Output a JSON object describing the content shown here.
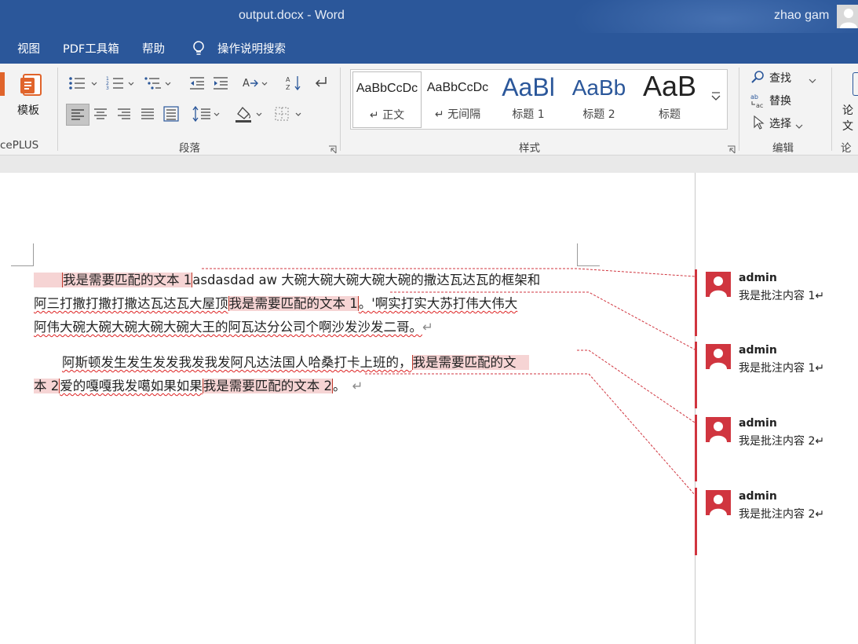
{
  "window": {
    "title": "output.docx  -  Word",
    "user": "zhao gam"
  },
  "menu": [
    "视图",
    "PDF工具箱",
    "帮助",
    "操作说明搜索"
  ],
  "ribbon": {
    "left_button": "模板",
    "left_group_label": "cePLUS",
    "paragraph_label": "段落",
    "styles_label": "样式",
    "editing_label": "编辑",
    "paper_label": "论文",
    "paper_group_label": "论文",
    "styles": [
      {
        "preview": "AaBbCcDc",
        "name": "↵ 正文"
      },
      {
        "preview": "AaBbCcDc",
        "name": "↵ 无间隔"
      },
      {
        "preview": "AaBl",
        "name": "标题 1"
      },
      {
        "preview": "AaBb",
        "name": "标题 2"
      },
      {
        "preview": "AaB",
        "name": "标题"
      }
    ],
    "editing": {
      "find": "查找",
      "replace": "替换",
      "select": "选择"
    }
  },
  "document": {
    "p1_line1": {
      "hl": "我是需要匹配的文本 1",
      "rest": "asdasdad aw 大碗大碗大碗大碗大碗的撒达瓦达瓦的框架和"
    },
    "p1_line2": {
      "a": "阿三打撒打撒打撒达瓦达瓦大屋顶",
      "hl": "我是需要匹配的文本 1",
      "b": "。'啊实打实大苏打伟大伟大"
    },
    "p1_line3": {
      "text": "阿伟大碗大碗大碗大碗大碗大王的阿瓦达分公司个啊沙发沙发二哥。",
      "mark": "↵"
    },
    "p2_line1": {
      "a": "阿斯顿发生发生发发我发我发阿凡达法国人哈桑打卡上班的，",
      "hl": "我是需要匹配的文"
    },
    "p2_line2": {
      "hl1": "本 2",
      "a": "爱的嘎嘎我发噶如果如果",
      "hl2": "我是需要匹配的文本 2",
      "b": "。",
      "mark": "↵"
    }
  },
  "comments": [
    {
      "author": "admin",
      "text": "我是批注内容 1↵"
    },
    {
      "author": "admin",
      "text": "我是批注内容 1↵"
    },
    {
      "author": "admin",
      "text": "我是批注内容 2↵"
    },
    {
      "author": "admin",
      "text": "我是批注内容 2↵"
    }
  ],
  "colors": {
    "title_bar": "#2b579a",
    "comment_accent": "#d0353f",
    "highlight": "#f6d4d4"
  }
}
